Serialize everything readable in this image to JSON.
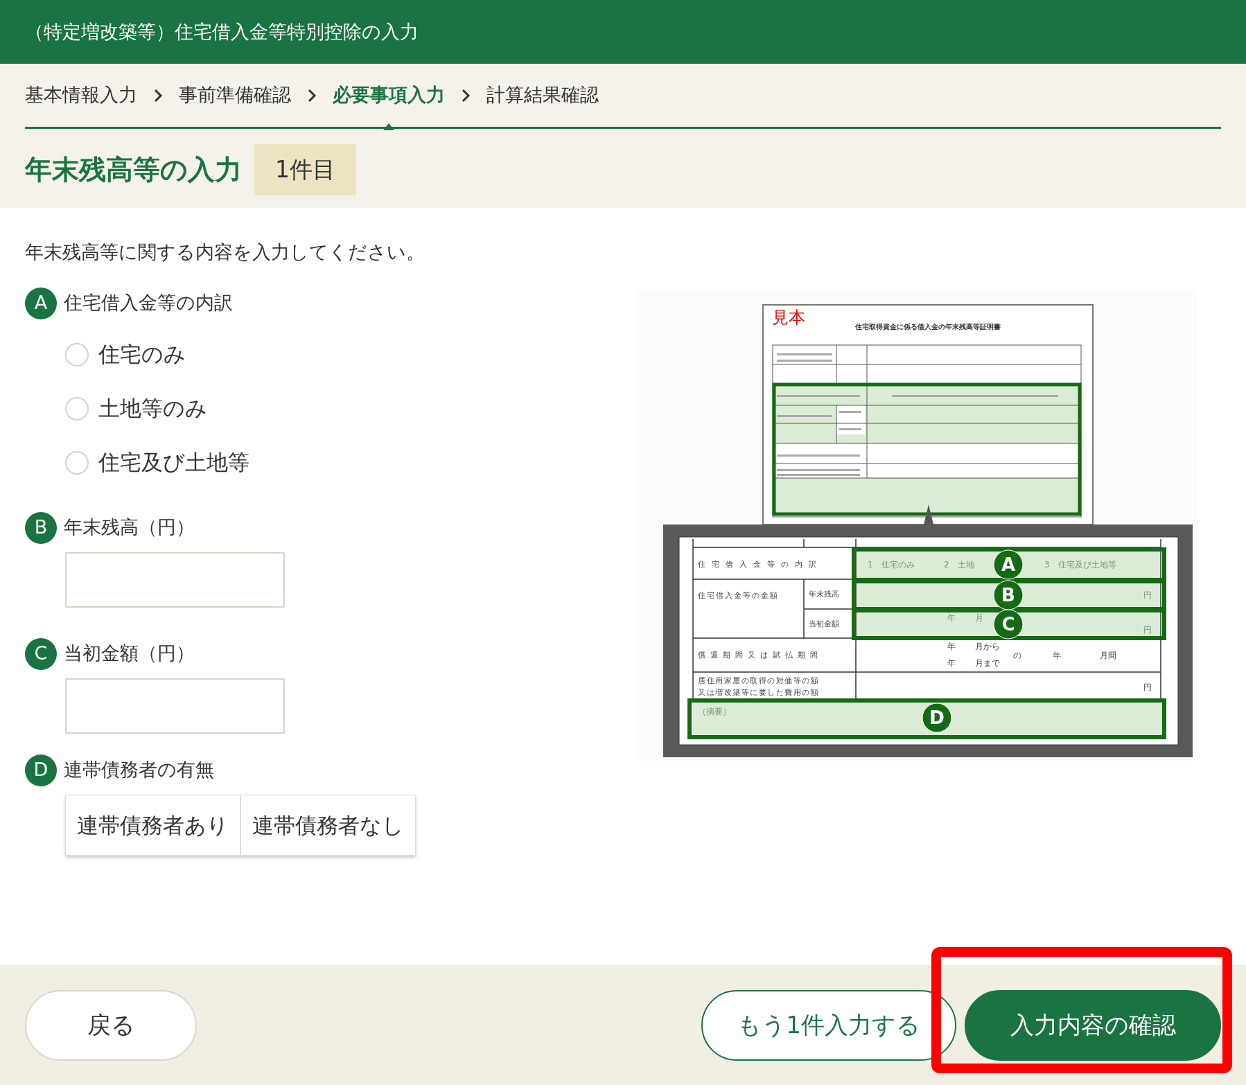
{
  "header": {
    "title": "（特定増改築等）住宅借入金等特別控除の入力"
  },
  "breadcrumbs": [
    {
      "label": "基本情報入力",
      "selected": false
    },
    {
      "label": "事前準備確認",
      "selected": false
    },
    {
      "label": "必要事項入力",
      "selected": true
    },
    {
      "label": "計算結果確認",
      "selected": false
    }
  ],
  "heading": {
    "title": "年末残高等の入力",
    "badge": "1件目"
  },
  "intro": "年末残高等に関する内容を入力してください。",
  "sections": [
    {
      "marker": "A",
      "label": "住宅借入金等の内訳",
      "kind": "radio",
      "options": [
        {
          "label": "住宅のみ",
          "checked": false
        },
        {
          "label": "土地等のみ",
          "checked": false
        },
        {
          "label": "住宅及び土地等",
          "checked": false
        }
      ]
    },
    {
      "marker": "B",
      "label": "年末残高（円）",
      "kind": "input"
    },
    {
      "marker": "C",
      "label": "当初金額（円）",
      "kind": "input"
    },
    {
      "marker": "D",
      "label": "連帯債務者の有無",
      "kind": "toggle",
      "options": [
        {
          "label": "連帯債務者あり",
          "selected": false
        },
        {
          "label": "連帯債務者なし",
          "selected": false
        }
      ]
    }
  ],
  "sample": {
    "stamp": "見本",
    "doc_title": "住宅取得資金に係る借入金の年末残高等証明書",
    "breakdown": {
      "label": "住宅借入金等の内訳",
      "choices": [
        "1　住宅のみ",
        "2　土地",
        "3　住宅及び土地等"
      ],
      "marker": "A"
    },
    "amount": {
      "label": "住宅借入金等の金額",
      "year_end": {
        "label": "年末残高",
        "unit": "円",
        "marker": "B"
      },
      "initial": {
        "label": "当初金額",
        "date": [
          "年",
          "月"
        ],
        "unit": "円",
        "marker": "C"
      }
    },
    "period": {
      "label": "償還期間又は賦払期間",
      "from": [
        "年",
        "月から"
      ],
      "to": [
        "年",
        "月まで"
      ],
      "joiner": "の",
      "total": [
        "年",
        "月間"
      ]
    },
    "cost": {
      "label": [
        "居住用家屋の取得の対価等の額",
        "又は増改築等に要した費用の額"
      ],
      "unit": "円"
    },
    "remarks": {
      "label": "（摘要）",
      "marker": "D"
    }
  },
  "footer": {
    "buttons": [
      {
        "label": "戻る",
        "kind": "back",
        "highlighted": false
      },
      {
        "label": "もう1件入力する",
        "kind": "outline",
        "highlighted": false
      },
      {
        "label": "入力内容の確認",
        "kind": "primary",
        "highlighted": true
      }
    ]
  }
}
